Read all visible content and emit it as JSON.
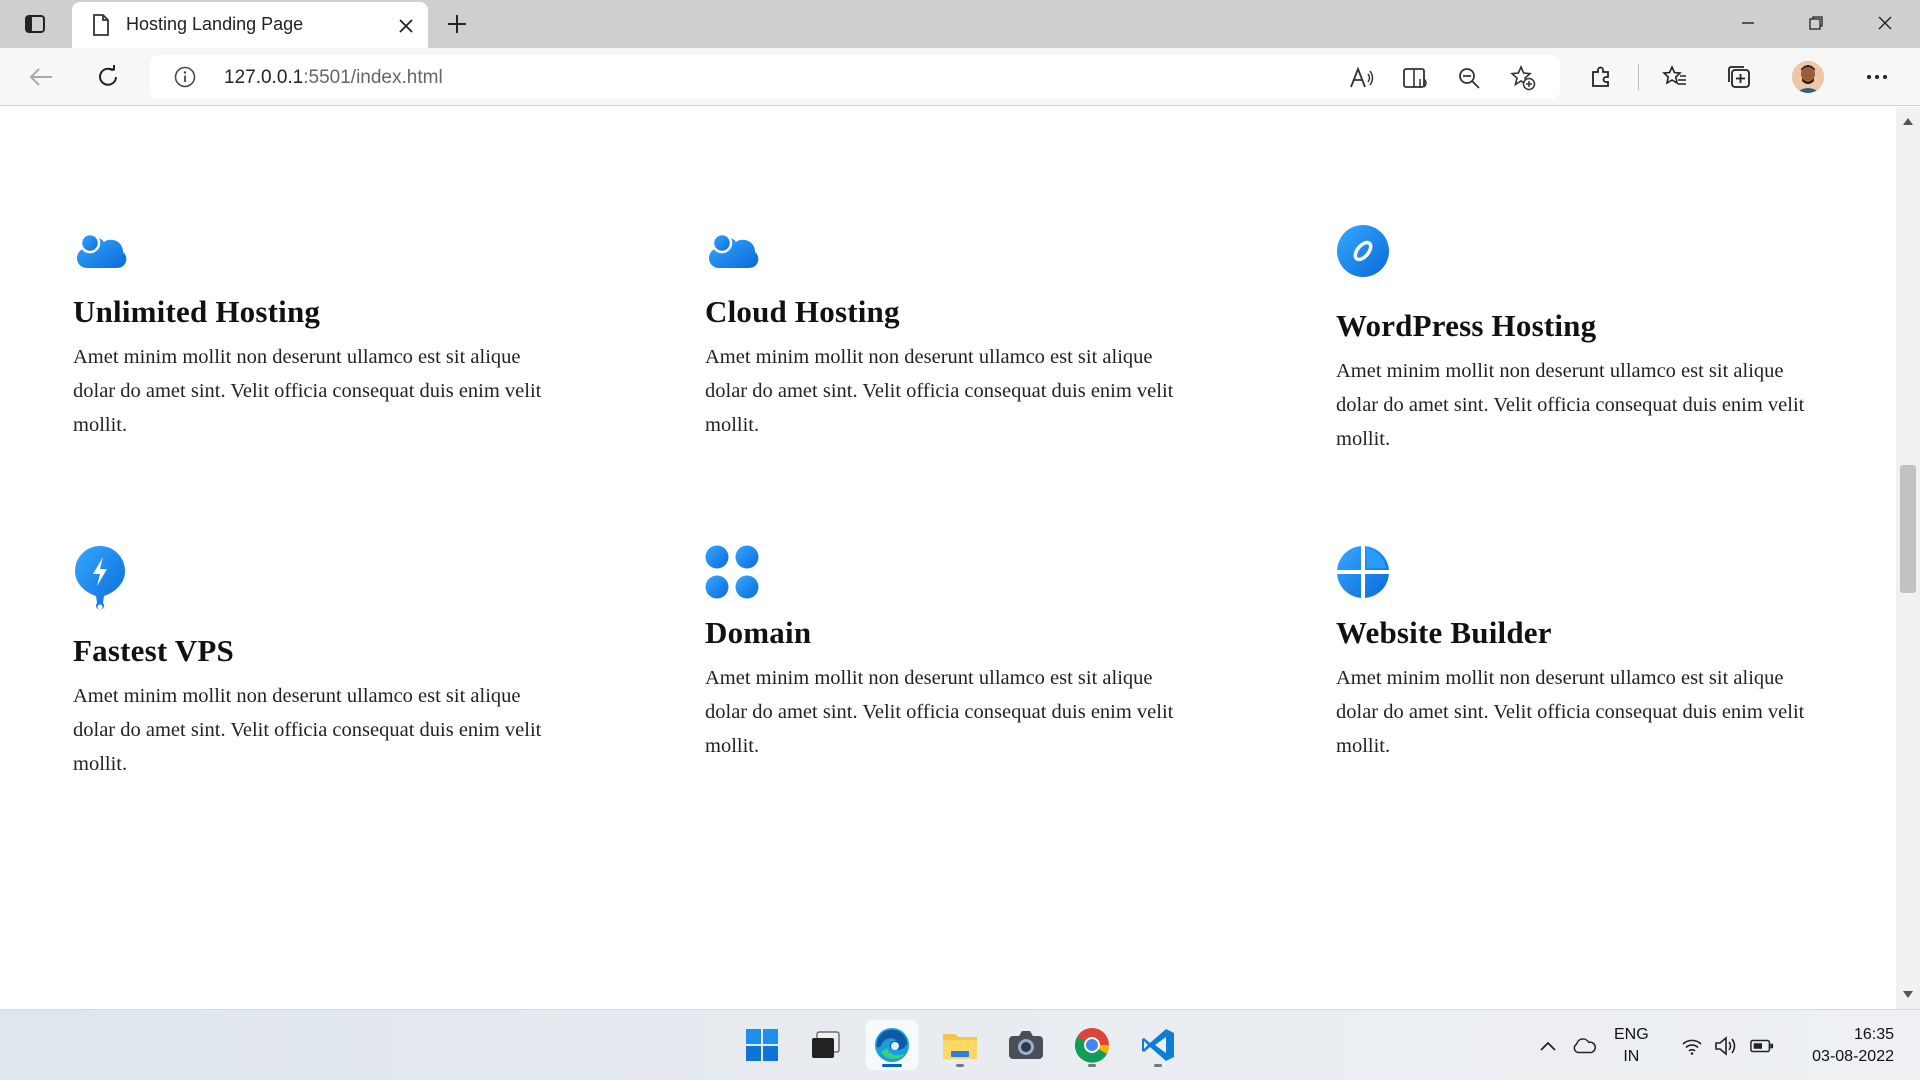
{
  "browser": {
    "tab_title": "Hosting Landing Page",
    "url_host": "127.0.0.1",
    "url_rest": ":5501/index.html",
    "icons": {
      "tab_actions": "tab-actions-icon",
      "favicon": "page-icon",
      "close": "close-icon",
      "new_tab": "plus-icon",
      "back": "arrow-left-icon",
      "refresh": "refresh-icon",
      "info": "info-icon",
      "read_aloud": "read-aloud-icon",
      "immersive_reader": "immersive-reader-icon",
      "zoom": "zoom-out-icon",
      "favorite_add": "star-add-icon",
      "extensions": "puzzle-icon",
      "favorites": "favorites-icon",
      "collections": "collections-icon",
      "more": "more-icon"
    }
  },
  "features": [
    {
      "title": "Unlimited Hosting",
      "desc": "Amet minim mollit non deserunt ullamco est sit alique dolar do amet sint. Velit officia consequat duis enim velit mollit.",
      "icon": "cloud-icon"
    },
    {
      "title": "Cloud Hosting",
      "desc": "Amet minim mollit non deserunt ullamco est sit alique dolar do amet sint. Velit officia consequat duis enim velit mollit.",
      "icon": "cloud-icon"
    },
    {
      "title": "WordPress Hosting",
      "desc": "Amet minim mollit non deserunt ullamco est sit alique dolar do amet sint. Velit officia consequat duis enim velit mollit.",
      "icon": "compass-icon"
    },
    {
      "title": "Fastest VPS",
      "desc": "Amet minim mollit non deserunt ullamco est sit alique dolar do amet sint. Velit officia consequat duis enim velit mollit.",
      "icon": "bolt-pin-icon"
    },
    {
      "title": "Domain",
      "desc": "Amet minim mollit non deserunt ullamco est sit alique dolar do amet sint. Velit officia consequat duis enim velit mollit.",
      "icon": "grid-dots-icon"
    },
    {
      "title": "Website Builder",
      "desc": "Amet minim mollit non deserunt ullamco est sit alique dolar do amet sint. Velit officia consequat duis enim velit mollit.",
      "icon": "pie-chart-icon"
    }
  ],
  "taskbar": {
    "lang_line1": "ENG",
    "lang_line2": "IN",
    "time": "16:35",
    "date": "03-08-2022",
    "apps": [
      "windows-start-icon",
      "task-view-icon",
      "edge-icon",
      "file-explorer-icon",
      "camera-icon",
      "chrome-icon",
      "vscode-icon"
    ]
  },
  "colors": {
    "accent_blue": "#1a8cf0",
    "accent_blue_dark": "#0b6fd8"
  }
}
